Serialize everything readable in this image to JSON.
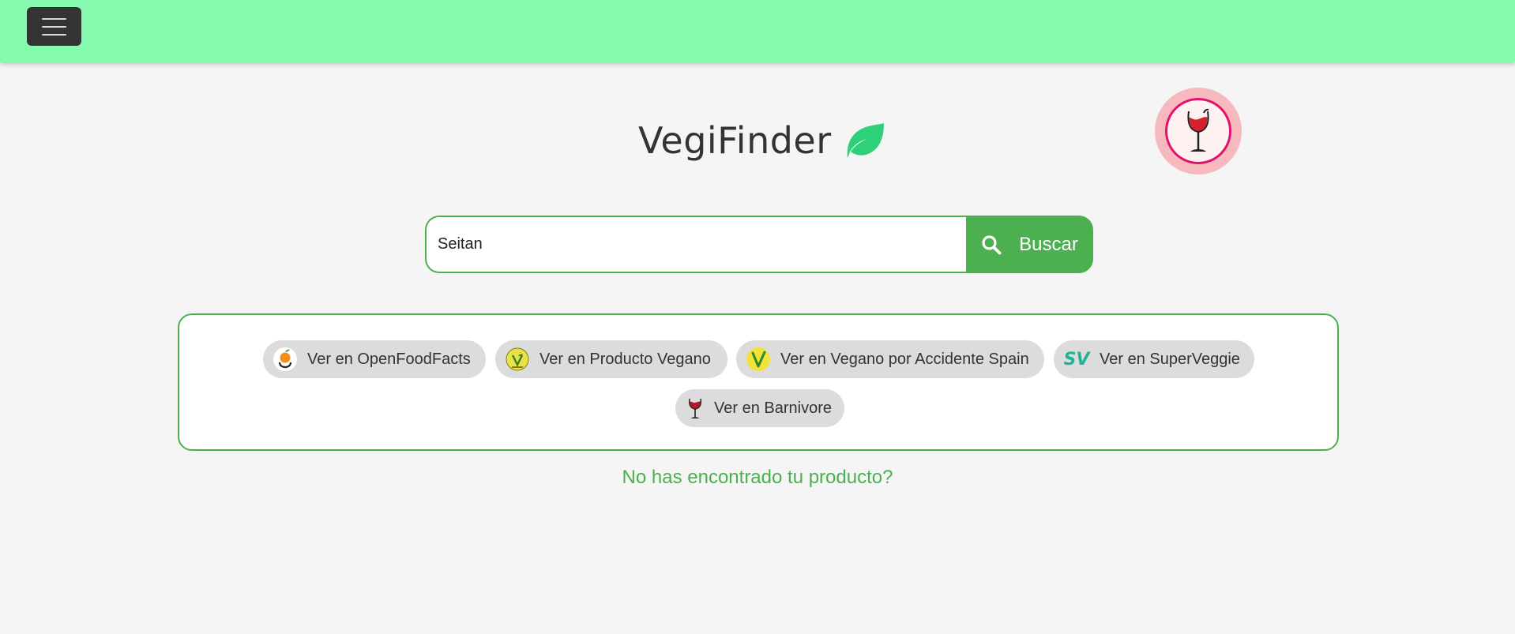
{
  "header": {
    "menu_icon": "hamburger-icon",
    "background": "#86fbb0"
  },
  "brand": {
    "title": "VegiFinder",
    "icon": "leaf-icon",
    "leaf_color": "#2ed179"
  },
  "badge": {
    "icon": "wine-glass-icon"
  },
  "search": {
    "value": "Seitan",
    "button_label": "Buscar",
    "button_icon": "search-icon",
    "accent": "#4caf50"
  },
  "links": [
    {
      "label": "Ver en OpenFoodFacts",
      "icon": "openfoodfacts-icon"
    },
    {
      "label": "Ver en Producto Vegano",
      "icon": "producto-vegano-icon"
    },
    {
      "label": "Ver en Vegano por Accidente Spain",
      "icon": "vegano-por-accidente-icon"
    },
    {
      "label": "Ver en SuperVeggie",
      "icon": "superveggie-icon",
      "icon_text": "SV"
    },
    {
      "label": "Ver en Barnivore",
      "icon": "barnivore-icon"
    }
  ],
  "not_found": {
    "label": "No has encontrado tu producto?"
  }
}
